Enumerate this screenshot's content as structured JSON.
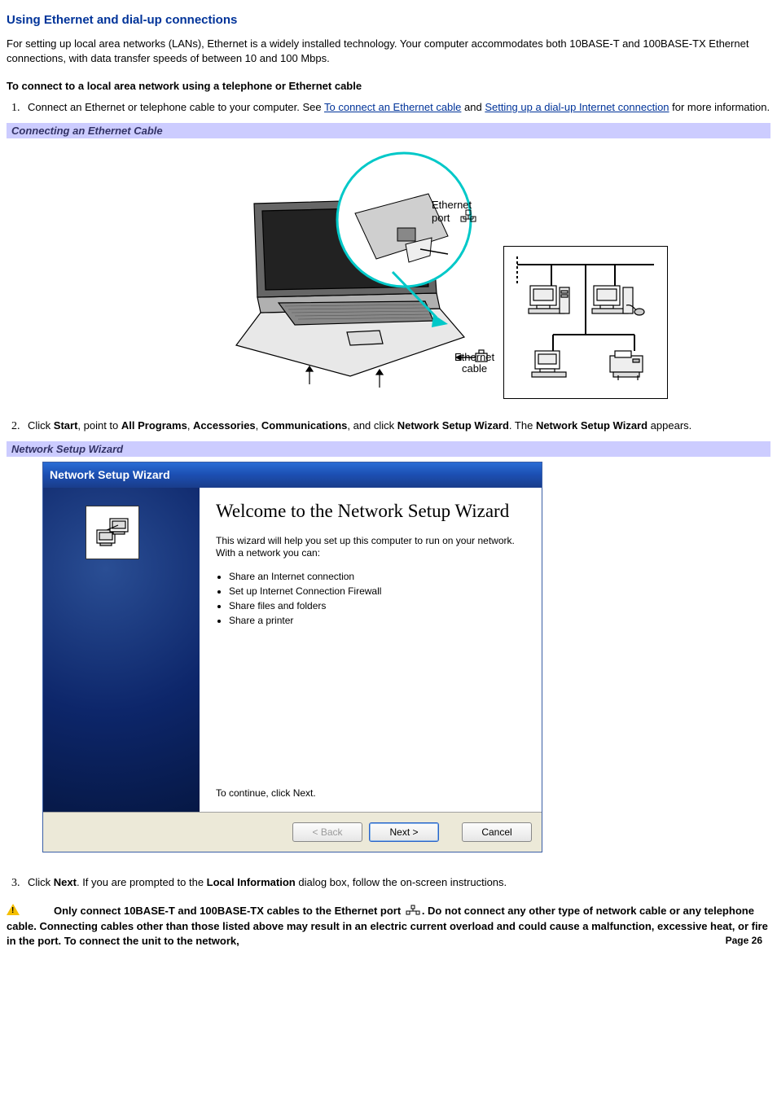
{
  "title": "Using Ethernet and dial-up connections",
  "intro": "For setting up local area networks (LANs), Ethernet is a widely installed technology. Your computer accommodates both 10BASE-T and 100BASE-TX Ethernet connections, with data transfer speeds of between 10 and 100 Mbps.",
  "subheading": "To connect to a local area network using a telephone or Ethernet cable",
  "step1_before": "Connect an Ethernet or telephone cable to your computer. See ",
  "step1_link1": "To connect an Ethernet cable",
  "step1_mid": " and ",
  "step1_link2": "Setting up a dial-up Internet connection",
  "step1_after": " for more information.",
  "caption1": "Connecting an Ethernet Cable",
  "fig1": {
    "port_label": "Ethernet\nport",
    "cable_label": "Ethernet\ncable"
  },
  "step2_a": "Click ",
  "step2_b": "Start",
  "step2_c": ", point to ",
  "step2_d": "All Programs",
  "step2_e": ", ",
  "step2_f": "Accessories",
  "step2_g": ", ",
  "step2_h": "Communications",
  "step2_i": ", and click ",
  "step2_j": "Network Setup Wizard",
  "step2_k": ". The ",
  "step2_l": "Network Setup Wizard",
  "step2_m": " appears.",
  "caption2": "Network Setup Wizard",
  "wizard": {
    "title": "Network Setup Wizard",
    "heading": "Welcome to the Network Setup Wizard",
    "desc": "This wizard will help you set up this computer to run on your network. With a network you can:",
    "bullets": [
      "Share an Internet connection",
      "Set up Internet Connection Firewall",
      "Share files and folders",
      "Share a printer"
    ],
    "continue": "To continue, click Next.",
    "back": "< Back",
    "next": "Next >",
    "cancel": "Cancel"
  },
  "step3_a": "Click ",
  "step3_b": "Next",
  "step3_c": ". If you are prompted to the ",
  "step3_d": "Local Information",
  "step3_e": " dialog box, follow the on-screen instructions.",
  "warning_a": "Only connect 10BASE-T and 100BASE-TX cables to the Ethernet port ",
  "warning_b": ". Do not connect any other type of network cable or any telephone cable. Connecting cables other than those listed above may result in an electric current overload and could cause a malfunction, excessive heat, or fire in the port. To connect the unit to the network,",
  "page_num": "Page 26"
}
